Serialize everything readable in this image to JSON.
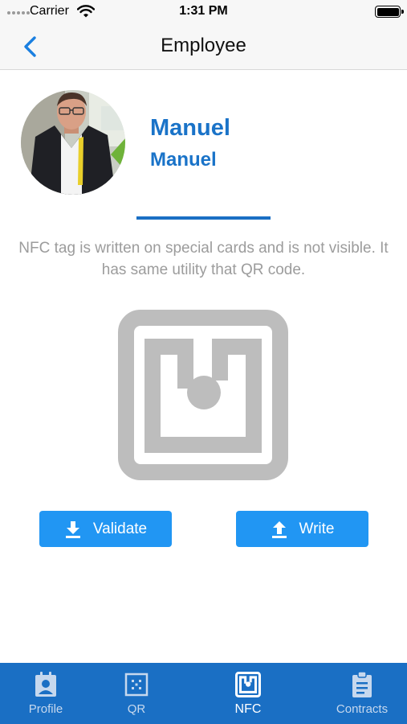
{
  "status_bar": {
    "carrier": "Carrier",
    "time": "1:31 PM"
  },
  "nav": {
    "title": "Employee",
    "back_icon": "chevron-left-icon"
  },
  "profile": {
    "first_name": "Manuel",
    "second_name": "Manuel"
  },
  "description": "NFC tag is written on special cards and is not visible. It has same utility that QR code.",
  "buttons": {
    "validate_label": "Validate",
    "write_label": "Write"
  },
  "tabs": [
    {
      "label": "Profile",
      "icon": "profile-card-icon",
      "active": false
    },
    {
      "label": "QR",
      "icon": "qr-icon",
      "active": false
    },
    {
      "label": "NFC",
      "icon": "nfc-icon",
      "active": true
    },
    {
      "label": "Contracts",
      "icon": "clipboard-icon",
      "active": false
    }
  ],
  "colors": {
    "accent": "#1a73c8",
    "button": "#2196f3",
    "tab_bar": "#1a6fc4",
    "muted_text": "#9c9c9c",
    "nfc_graphic": "#bdbdbd"
  }
}
